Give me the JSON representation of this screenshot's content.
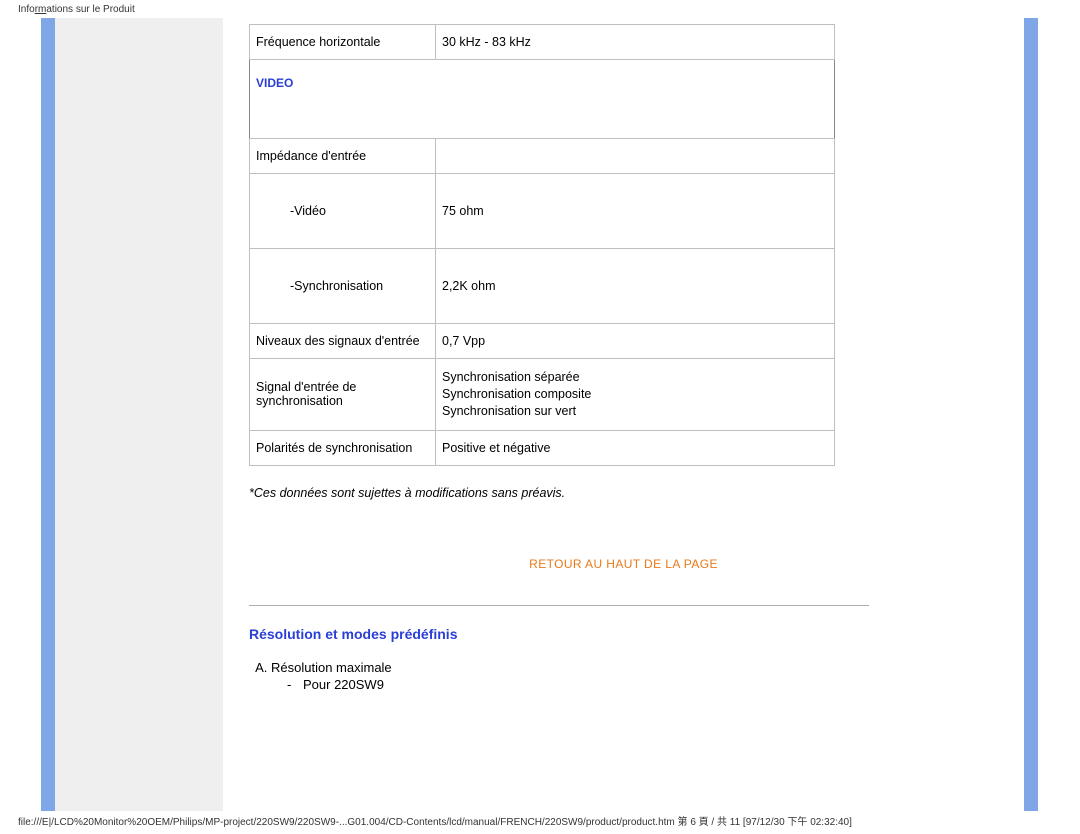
{
  "header": {
    "label_pre": "Info",
    "label_underline": "rm",
    "label_post": "ations sur le Produit"
  },
  "table": {
    "row_freq": {
      "label": "Fréquence horizontale",
      "value": "30 kHz - 83 kHz"
    },
    "section_video": "VIDEO",
    "row_imp": {
      "label": "Impédance d'entrée",
      "value": ""
    },
    "row_video": {
      "label": "-Vidéo",
      "value": "75 ohm"
    },
    "row_sync": {
      "label": "-Synchronisation",
      "value": "2,2K ohm"
    },
    "row_levels": {
      "label": "Niveaux des signaux d'entrée",
      "value": "0,7 Vpp"
    },
    "row_syncin": {
      "label": "Signal d'entrée de synchronisation",
      "v1": "Synchronisation séparée",
      "v2": "Synchronisation composite",
      "v3": "Synchronisation sur vert"
    },
    "row_pol": {
      "label": "Polarités de synchronisation",
      "value": "Positive et négative"
    }
  },
  "note": "*Ces données sont sujettes à modifications sans préavis.",
  "retour_link": "RETOUR AU HAUT DE LA PAGE",
  "section_title": "Résolution et modes prédéfinis",
  "list": {
    "item_a": "Résolution maximale",
    "sub_a1": "Pour 220SW9"
  },
  "footer_path": "file:///E|/LCD%20Monitor%20OEM/Philips/MP-project/220SW9/220SW9-...G01.004/CD-Contents/lcd/manual/FRENCH/220SW9/product/product.htm 第 6 頁 / 共 11  [97/12/30 下午 02:32:40]"
}
